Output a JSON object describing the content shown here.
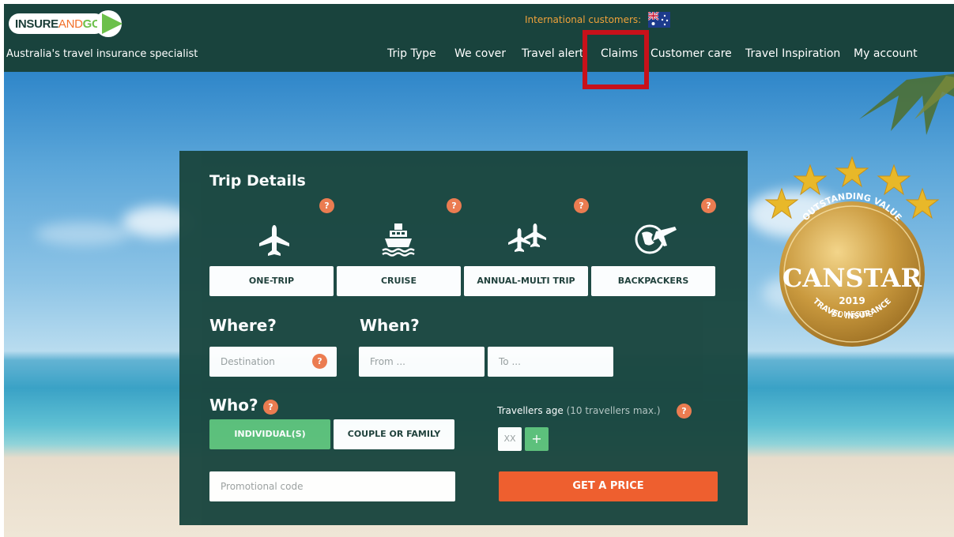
{
  "header": {
    "logo": {
      "part1": "INSURE",
      "part2": "AND",
      "part3": "GO"
    },
    "tagline": "Australia's travel insurance specialist",
    "international_label": "International customers:",
    "nav": [
      "Trip Type",
      "We cover",
      "Travel alert",
      "Claims",
      "Customer care",
      "Travel Inspiration",
      "My account"
    ]
  },
  "form": {
    "title": "Trip Details",
    "help_glyph": "?",
    "trip_types": [
      {
        "label": "ONE-TRIP",
        "icon": "plane-icon"
      },
      {
        "label": "CRUISE",
        "icon": "cruise-ship-icon"
      },
      {
        "label": "ANNUAL-MULTI TRIP",
        "icon": "multi-plane-icon"
      },
      {
        "label": "BACKPACKERS",
        "icon": "globe-plane-icon"
      }
    ],
    "where_heading": "Where?",
    "when_heading": "When?",
    "destination_placeholder": "Destination",
    "from_placeholder": "From ...",
    "to_placeholder": "To ...",
    "who_heading": "Who?",
    "who_options": [
      "INDIVIDUAL(S)",
      "COUPLE OR FAMILY"
    ],
    "travellers_label": "Travellers age",
    "travellers_sub": "(10 travellers max.)",
    "age_placeholder": "XX",
    "add_glyph": "+",
    "promo_placeholder": "Promotional code",
    "cta": "GET A PRICE"
  },
  "badge": {
    "top": "OUTSTANDING VALUE",
    "brand": "CANSTAR",
    "year": "2019",
    "line1": "DOMESTIC",
    "line2": "TRAVEL INSURANCE"
  },
  "colors": {
    "header_bg": "#19433d",
    "panel_bg": "#1b4740",
    "accent_orange": "#ef5b2a",
    "selected_green": "#5cc07a",
    "highlight_red": "#c8111a"
  }
}
